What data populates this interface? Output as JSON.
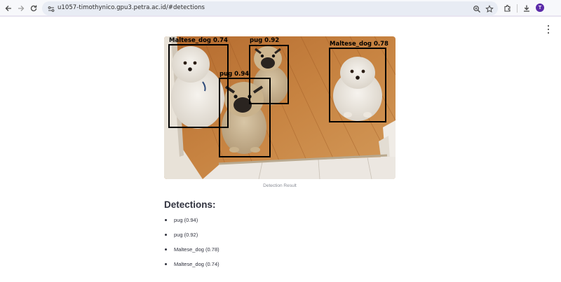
{
  "browser": {
    "url": "u1057-timothynico.gpu3.petra.ac.id/#detections",
    "profile_initial": "T",
    "icons": [
      "back-icon",
      "forward-icon",
      "reload-icon",
      "site-info-icon",
      "zoom-icon",
      "bookmark-star-icon",
      "extensions-icon",
      "download-icon",
      "avatar"
    ]
  },
  "result_image": {
    "caption": "Detection Result",
    "boxes": [
      {
        "label": "Maltese_dog 0.74"
      },
      {
        "label": "pug 0.92"
      },
      {
        "label": "pug 0.94"
      },
      {
        "label": "Maltese_dog 0.78"
      }
    ]
  },
  "detections": {
    "heading": "Detections:",
    "items": [
      "pug (0.94)",
      "pug (0.92)",
      "Maltese_dog (0.78)",
      "Maltese_dog (0.74)"
    ]
  },
  "colors": {
    "heading_text": "#31333f",
    "caption_text": "#8a8d96",
    "bbox_stroke": "#000000",
    "avatar_bg": "#5b2aa8"
  }
}
